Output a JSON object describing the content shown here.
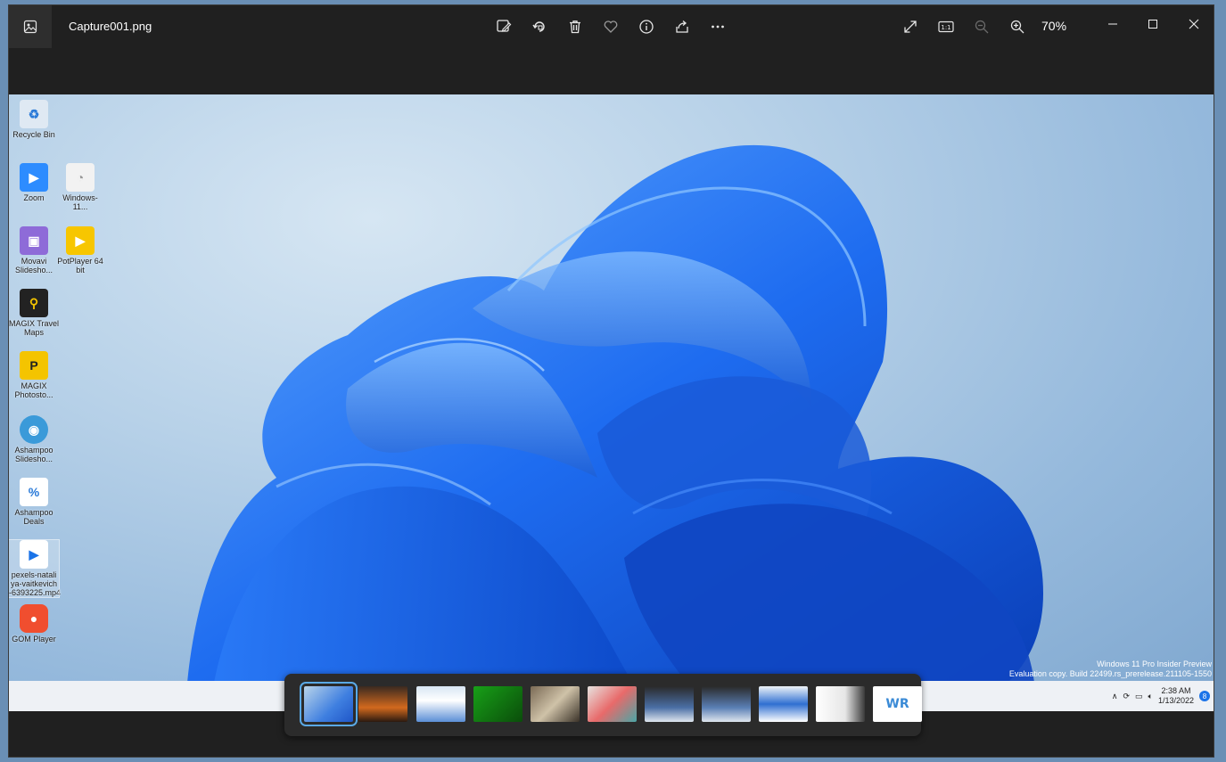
{
  "window": {
    "filename": "Capture001.png",
    "zoom": "70%"
  },
  "toolbar": {
    "icons": [
      "edit-image-icon",
      "rotate-icon",
      "delete-icon",
      "favorite-icon",
      "info-icon",
      "share-icon",
      "more-icon"
    ],
    "right_icons": [
      "fit-to-window-icon",
      "actual-size-icon",
      "zoom-out-icon",
      "zoom-in-icon"
    ]
  },
  "desktop_icons": [
    {
      "label": "Recycle Bin",
      "color": "#dfe9f3",
      "glyph": "♻"
    },
    {
      "label": "Zoom",
      "color": "#2d8cff",
      "glyph": "▶"
    },
    {
      "label": "Windows-11...",
      "color": "#f2f2f2",
      "glyph": "◔"
    },
    {
      "label": "Movavi Slidesho...",
      "color": "#8e6bd8",
      "glyph": "▣"
    },
    {
      "label": "PotPlayer 64 bit",
      "color": "#f7c600",
      "glyph": "▶"
    },
    {
      "label": "MAGIX Travel Maps",
      "color": "#222222",
      "glyph": "⚲"
    },
    {
      "label": "MAGIX Photosto...",
      "color": "#f4c400",
      "glyph": "P"
    },
    {
      "label": "Ashampoo Slidesho...",
      "color": "#3a9ad9",
      "glyph": "◉"
    },
    {
      "label": "Ashampoo Deals",
      "color": "#ffffff",
      "glyph": "%"
    },
    {
      "label": "pexels-natali ya-vaitkevich -6393225.mp4",
      "color": "#ffffff",
      "glyph": "▶"
    },
    {
      "label": "GOM Player",
      "color": "#f04e2f",
      "glyph": "●"
    }
  ],
  "watermark": {
    "line1": "Windows 11 Pro Insider Preview",
    "line2": "Evaluation copy. Build 22499.rs_prerelease.211105-1550"
  },
  "taskbar": {
    "time": "2:38 AM",
    "date": "1/13/2022",
    "notification_count": "8"
  },
  "filmstrip": {
    "thumbnails": [
      {
        "name": "bloom-wallpaper",
        "bg": "linear-gradient(135deg,#b9d4ea,#3f7fe0 60%,#1f56c8)",
        "selected": true
      },
      {
        "name": "fire-landscape",
        "bg": "linear-gradient(180deg,#3a2a20,#d2691e 60%,#2a1a10)",
        "selected": false
      },
      {
        "name": "windows-screenshot-1",
        "bg": "linear-gradient(180deg,#d8e6f4,#ffffff 40%,#5b8fd6)",
        "selected": false
      },
      {
        "name": "xbox-console",
        "bg": "linear-gradient(135deg,#18a018,#0a4d0a)",
        "selected": false
      },
      {
        "name": "keyboard-keys",
        "bg": "linear-gradient(135deg,#7a6a55,#cfc2a8 50%,#3a3228)",
        "selected": false
      },
      {
        "name": "keycaps-colorful",
        "bg": "linear-gradient(135deg,#e7e3e0,#e86a6a 50%,#4aa6a6)",
        "selected": false
      },
      {
        "name": "dark-app-screenshot-1",
        "bg": "linear-gradient(180deg,#2a2a2a,#4a6fa5 60%,#dfe6ee)",
        "selected": false
      },
      {
        "name": "dark-app-screenshot-2",
        "bg": "linear-gradient(180deg,#2a2a2a,#5a7fb5 60%,#dfe6ee)",
        "selected": false
      },
      {
        "name": "settings-screenshot",
        "bg": "linear-gradient(180deg,#eef3f8,#2f6fd1 50%,#ffffff)",
        "selected": false
      },
      {
        "name": "explorer-screenshot",
        "bg": "linear-gradient(90deg,#ffffff,#e6e6e6 60%,#3a3a3a)",
        "selected": false
      },
      {
        "name": "wr-logo",
        "bg": "#ffffff",
        "selected": false,
        "text": "WR"
      }
    ]
  }
}
